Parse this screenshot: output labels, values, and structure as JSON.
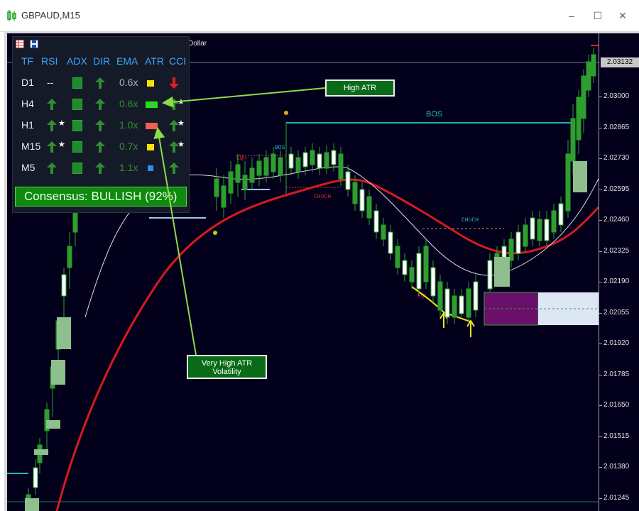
{
  "window": {
    "title": "GBPAUD,M15",
    "minimize": "–",
    "maximize": "☐",
    "close": "✕"
  },
  "symbol_fragment": "Dollar",
  "price_axis": {
    "current": "2.03132",
    "labels": [
      "2.03000",
      "2.02865",
      "2.02730",
      "2.02595",
      "2.02460",
      "2.02325",
      "2.02190",
      "2.02055",
      "2.01920",
      "2.01785",
      "2.01650",
      "2.01515",
      "2.01380",
      "2.01245"
    ]
  },
  "dashboard": {
    "headers": [
      "TF",
      "RSI",
      "ADX",
      "DIR",
      "EMA",
      "ATR",
      "CCI"
    ],
    "rows": [
      {
        "tf": "D1",
        "rsi": "--",
        "rsi_star": "",
        "ema": "0.6x",
        "ema_color": "#b5b5b5",
        "atr_color": "#f2e600",
        "atr_size": "small",
        "cci_dir": "down",
        "cci_star": ""
      },
      {
        "tf": "H4",
        "rsi": "up",
        "rsi_star": "",
        "ema": "0.6x",
        "ema_color": "#2f8f2f",
        "atr_color": "#22dd22",
        "atr_size": "wide",
        "cci_dir": "up",
        "cci_star": "★"
      },
      {
        "tf": "H1",
        "rsi": "up",
        "rsi_star": "★",
        "ema": "1.0x",
        "ema_color": "#2f8f2f",
        "atr_color": "#ee5f4f",
        "atr_size": "wide",
        "cci_dir": "up",
        "cci_star": "★"
      },
      {
        "tf": "M15",
        "rsi": "up",
        "rsi_star": "★",
        "ema": "0.7x",
        "ema_color": "#2f8f2f",
        "atr_color": "#f2e600",
        "atr_size": "small",
        "cci_dir": "up",
        "cci_star": "★"
      },
      {
        "tf": "M5",
        "rsi": "up",
        "rsi_star": "",
        "ema": "1.1x",
        "ema_color": "#2f8f2f",
        "atr_color": "#2a8ff0",
        "atr_size": "tiny",
        "cci_dir": "up",
        "cci_star": ""
      }
    ],
    "consensus": "Consensus: BULLISH (92%)"
  },
  "callouts": {
    "high_atr": "High ATR",
    "very_high_atr_line1": "Very High ATR",
    "very_high_atr_line2": "Volatility"
  },
  "chart_labels": {
    "bos_main": "BOS",
    "bos_small": "BOS",
    "choch_1": "CHoCH",
    "choch_2": "CHoCH",
    "eqh": "EQH",
    "eqs": "EQL"
  },
  "colors": {
    "bull": "#2e9e2e",
    "bear": "#d31f1f",
    "ema_slow": "#d41c1c",
    "ema_fast": "#e0e0e0",
    "bos": "#1fb8b8",
    "accent_callout": "#8edb4a"
  }
}
